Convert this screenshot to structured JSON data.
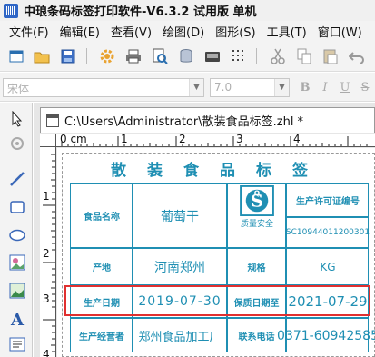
{
  "app": {
    "title": "中琅条码标签打印软件-V6.3.2 试用版 单机"
  },
  "menu": {
    "items": [
      "文件(F)",
      "编辑(E)",
      "查看(V)",
      "绘图(D)",
      "图形(S)",
      "工具(T)",
      "窗口(W)"
    ]
  },
  "toolbar": {
    "buttons": [
      "new",
      "open",
      "save",
      "settings",
      "print",
      "print-preview",
      "database",
      "single",
      "grid",
      "cut",
      "copy",
      "paste",
      "undo"
    ]
  },
  "format_bar": {
    "font_name": "宋体",
    "font_size": "7.0",
    "buttons": [
      "B",
      "I",
      "U",
      "S",
      "A",
      "A"
    ]
  },
  "document": {
    "tab_title": "C:\\Users\\Administrator\\散装食品标签.zhl *"
  },
  "ruler": {
    "unit": "0 cm",
    "h_marks": [
      "1",
      "2",
      "3",
      "4"
    ],
    "v_marks": [
      "1",
      "2",
      "3",
      "4"
    ]
  },
  "label": {
    "heading": "散装食品标签",
    "rows": [
      {
        "label1": "食品名称",
        "value1": "葡萄干",
        "label2": "",
        "value2": "生产许可证编号"
      },
      {
        "label1": "",
        "value1": "",
        "label2": "",
        "value2": "SC10944011200301"
      },
      {
        "label1": "产地",
        "value1": "河南郑州",
        "label2": "规格",
        "value2": "KG"
      },
      {
        "label1": "生产日期",
        "value1": "2019-07-30",
        "label2": "保质日期至",
        "value2": "2021-07-29"
      },
      {
        "label1": "生产经营者",
        "value1": "郑州食品加工厂",
        "label2": "联系电话",
        "value2": "0371-60942585"
      }
    ],
    "qs_caption": "质量安全"
  },
  "colors": {
    "label_blue": "#1f8fb3",
    "highlight_red": "#e03030"
  }
}
